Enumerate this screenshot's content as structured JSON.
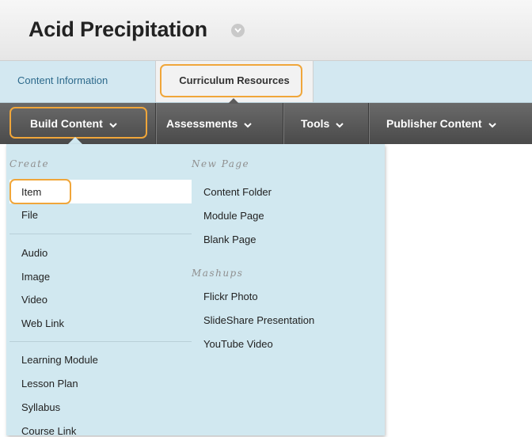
{
  "header": {
    "title": "Acid Precipitation"
  },
  "tabs": [
    {
      "label": "Content Information"
    },
    {
      "label": "Curriculum Resources"
    }
  ],
  "action_bar": {
    "build_content": "Build Content",
    "assessments": "Assessments",
    "tools": "Tools",
    "publisher_content": "Publisher Content"
  },
  "menu": {
    "create_heading": "Create",
    "create_items": [
      "Item",
      "File",
      "Audio",
      "Image",
      "Video",
      "Web Link",
      "Learning Module",
      "Lesson Plan",
      "Syllabus",
      "Course Link"
    ],
    "new_page_heading": "New Page",
    "new_page_items": [
      "Content Folder",
      "Module Page",
      "Blank Page"
    ],
    "mashups_heading": "Mashups",
    "mashups_items": [
      "Flickr Photo",
      "SlideShare Presentation",
      "YouTube Video"
    ]
  },
  "colors": {
    "highlight": "#f0a63a",
    "menu_bg": "#d1e8f0",
    "tab_bg": "#d3e8f1",
    "bar_bg": "#555555"
  }
}
